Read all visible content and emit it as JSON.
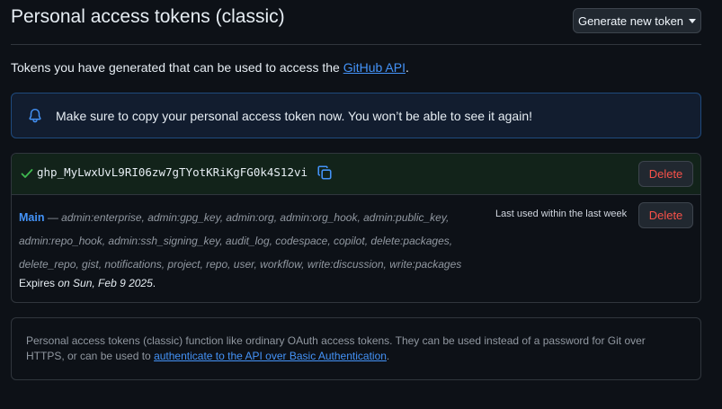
{
  "header": {
    "title": "Personal access tokens (classic)",
    "generate_button": "Generate new token"
  },
  "intro": {
    "text": "Tokens you have generated that can be used to access the ",
    "link": "GitHub API",
    "suffix": "."
  },
  "flash": {
    "message": "Make sure to copy your personal access token now. You won’t be able to see it again!"
  },
  "new_token": {
    "value": "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",
    "delete_label": "Delete"
  },
  "token": {
    "name": "Main",
    "dash": " — ",
    "scopes": "admin:enterprise, admin:gpg_key, admin:org, admin:org_hook, admin:public_key, admin:repo_hook, admin:ssh_signing_key, audit_log, codespace, copilot, delete:packages, delete_repo, gist, notifications, project, repo, user, workflow, write:discussion, write:packages",
    "last_used": "Last used within the last week",
    "delete_label": "Delete",
    "expires_prefix": "Expires ",
    "expires_date": "on Sun, Feb 9 2025",
    "expires_suffix": "."
  },
  "info": {
    "text": "Personal access tokens (classic) function like ordinary OAuth access tokens. They can be used instead of a password for Git over HTTPS, or can be used to ",
    "link": "authenticate to the API over Basic Authentication",
    "suffix": "."
  },
  "colors": {
    "background": "#0d1117",
    "link": "#4493f8",
    "danger": "#f85149",
    "success": "#3fb950",
    "flash_bg": "#121d2f"
  },
  "icons": {
    "flash": "bell-icon",
    "success": "check-icon",
    "copy": "copy-icon",
    "dropdown": "caret-down-icon"
  }
}
